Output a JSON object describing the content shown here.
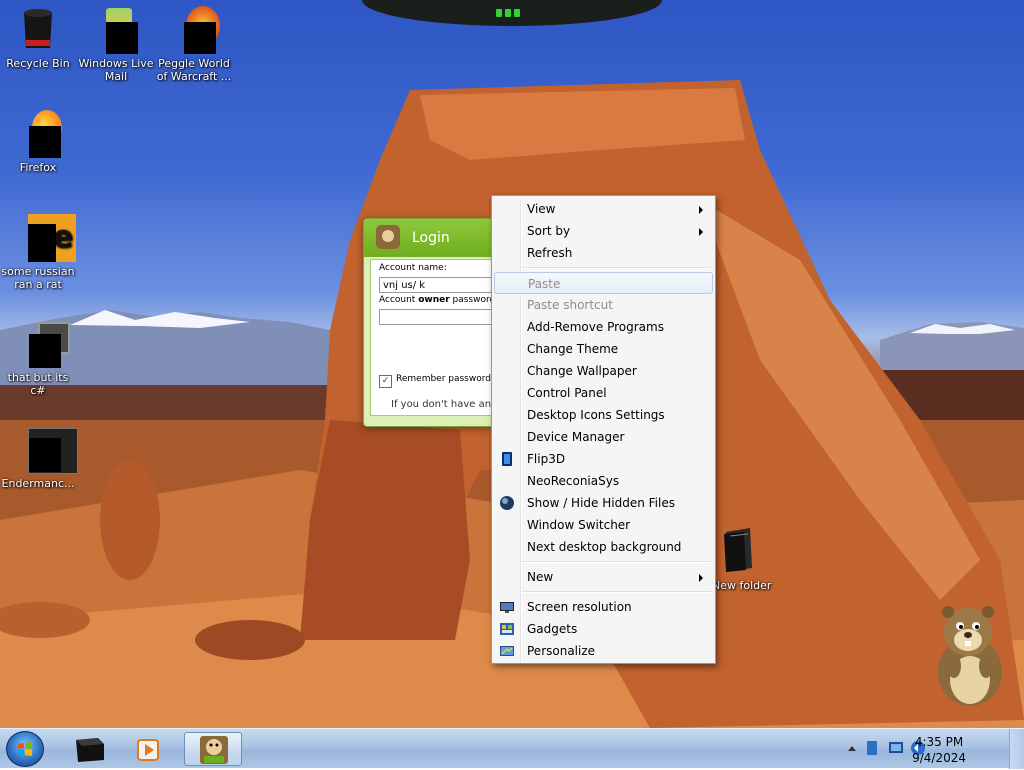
{
  "desktop_icons": [
    {
      "label": "Recycle Bin",
      "icon": "recycle-bin-icon"
    },
    {
      "label": "Windows Live Mail",
      "icon": "mail-icon"
    },
    {
      "label": "Peggle World of Warcraft ...",
      "icon": "peggle-icon"
    },
    {
      "label": "Firefox",
      "icon": "firefox-icon"
    },
    {
      "label": "some russian ran a rat",
      "icon": "app-icon"
    },
    {
      "label": "that but its c#",
      "icon": "app-icon"
    },
    {
      "label": "Endermanc...",
      "icon": "app-icon"
    }
  ],
  "login": {
    "title": "Login",
    "account_label": "Account name:",
    "account_value": "vnj us/ k",
    "password_label_prefix": "Account ",
    "password_label_bold": "owner",
    "password_label_suffix": " password",
    "remember_label": "Remember password",
    "remember_checked": true,
    "hint": "If you don't have an"
  },
  "context_menu": {
    "items": [
      {
        "label": "View",
        "submenu": true
      },
      {
        "label": "Sort by",
        "submenu": true
      },
      {
        "label": "Refresh"
      },
      {
        "label": "Paste",
        "disabled": true,
        "hover": true
      },
      {
        "label": "Paste shortcut",
        "disabled": true
      },
      {
        "label": "Add-Remove Programs"
      },
      {
        "label": "Change Theme"
      },
      {
        "label": "Change Wallpaper"
      },
      {
        "label": "Control Panel"
      },
      {
        "label": "Desktop Icons Settings"
      },
      {
        "label": "Device Manager"
      },
      {
        "label": "Flip3D",
        "icon": "flip3d-icon"
      },
      {
        "label": "NeoReconiaSys"
      },
      {
        "label": "Show / Hide Hidden Files",
        "icon": "globe-icon"
      },
      {
        "label": "Window Switcher"
      },
      {
        "label": "Next desktop background"
      },
      {
        "label": "New",
        "submenu": true
      },
      {
        "label": "Screen resolution",
        "icon": "monitor-icon"
      },
      {
        "label": "Gadgets",
        "icon": "gadgets-icon"
      },
      {
        "label": "Personalize",
        "icon": "personalize-icon"
      }
    ]
  },
  "desktop_folder": {
    "label": "New folder"
  },
  "taskbar": {
    "clock_time": "4:35 PM",
    "clock_date": "9/4/2024"
  }
}
